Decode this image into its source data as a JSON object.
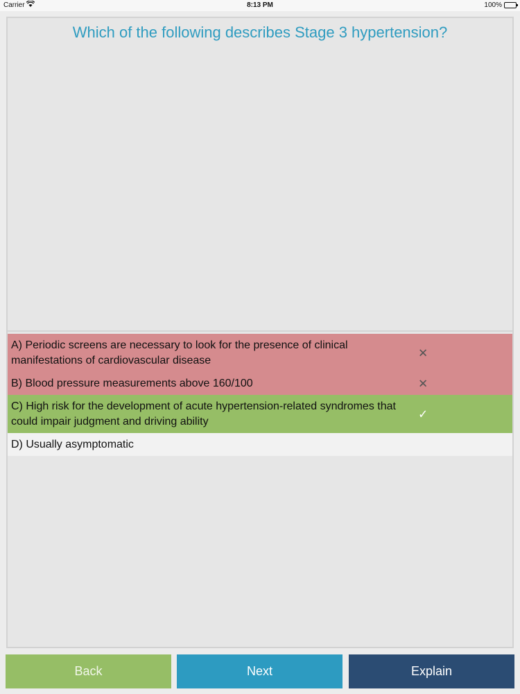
{
  "status_bar": {
    "carrier": "Carrier",
    "time": "8:13 PM",
    "battery": "100%"
  },
  "question": {
    "text": "Which of the following describes Stage 3 hypertension?"
  },
  "answers": [
    {
      "text": "A) Periodic screens are necessary to look for the presence of clinical manifestations of cardiovascular disease",
      "state": "wrong",
      "mark": "✕"
    },
    {
      "text": "B) Blood pressure measurements above 160/100",
      "state": "wrong",
      "mark": "✕"
    },
    {
      "text": "C) High risk for the development of acute hypertension-related syndromes that could impair judgment and driving ability",
      "state": "correct",
      "mark": "✓"
    },
    {
      "text": "D) Usually asymptomatic",
      "state": "neutral",
      "mark": ""
    }
  ],
  "buttons": {
    "back": "Back",
    "next": "Next",
    "explain": "Explain"
  },
  "colors": {
    "question": "#2f9cc0",
    "wrong": "#d58b8e",
    "correct": "#96be66",
    "back": "#96be66",
    "next": "#2d9bc1",
    "explain": "#2b4c73"
  }
}
